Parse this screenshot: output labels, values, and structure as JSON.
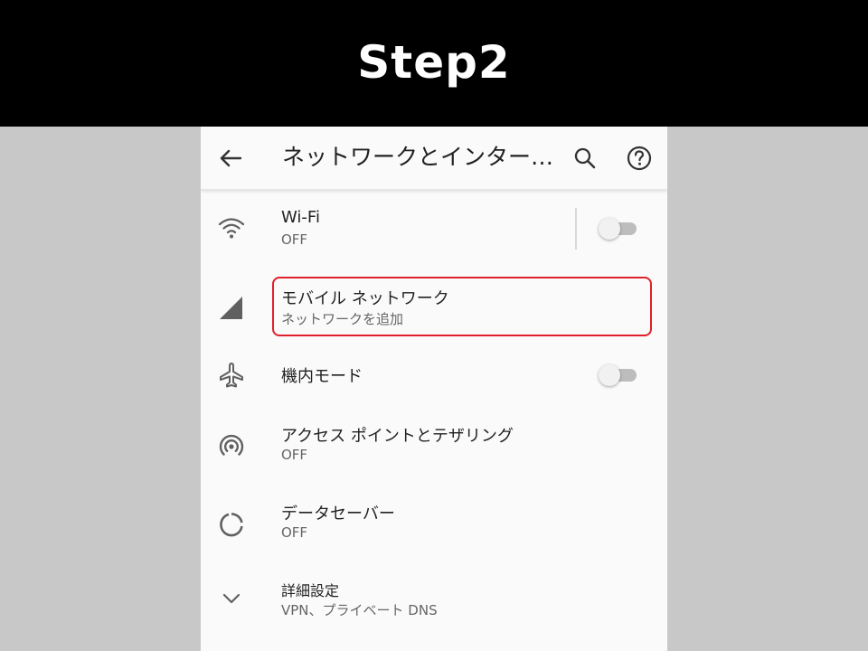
{
  "banner": {
    "title": "Step2"
  },
  "appbar": {
    "title": "ネットワークとインター…"
  },
  "rows": {
    "wifi": {
      "label": "Wi-Fi",
      "sub": "OFF"
    },
    "mobile": {
      "label": "モバイル ネットワーク",
      "sub": "ネットワークを追加"
    },
    "airplane": {
      "label": "機内モード"
    },
    "hotspot": {
      "label": "アクセス ポイントとテザリング",
      "sub": "OFF"
    },
    "datasaver": {
      "label": "データセーバー",
      "sub": "OFF"
    },
    "advanced": {
      "label": "詳細設定",
      "sub": "VPN、プライベート DNS"
    }
  },
  "toggles": {
    "wifi": "off",
    "airplane": "off"
  },
  "colors": {
    "banner_bg": "#000000",
    "highlight": "#e0202a",
    "icon": "#606060"
  }
}
